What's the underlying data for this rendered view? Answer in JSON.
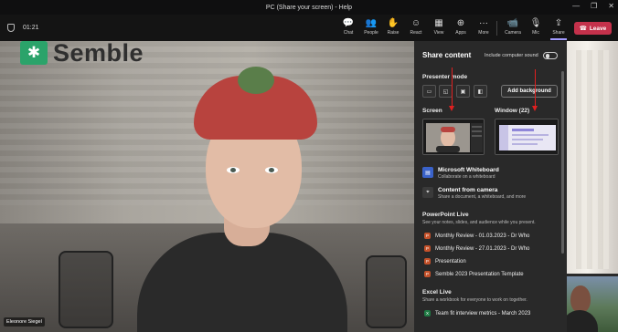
{
  "window": {
    "title": "PC (Share your screen) - Help",
    "min_glyph": "—",
    "max_glyph": "❐",
    "close_glyph": "✕"
  },
  "meeting": {
    "timer": "01:21"
  },
  "toolbar": {
    "buttons": [
      {
        "label": "Chat",
        "icon": "chat-icon",
        "glyph": "💬"
      },
      {
        "label": "People",
        "icon": "people-icon",
        "glyph": "👥"
      },
      {
        "label": "Raise",
        "icon": "raise-hand-icon",
        "glyph": "✋"
      },
      {
        "label": "React",
        "icon": "react-icon",
        "glyph": "☺"
      },
      {
        "label": "View",
        "icon": "view-icon",
        "glyph": "▦"
      },
      {
        "label": "Apps",
        "icon": "apps-icon",
        "glyph": "⊕"
      },
      {
        "label": "More",
        "icon": "more-icon",
        "glyph": "···"
      },
      {
        "label": "Camera",
        "icon": "camera-icon",
        "glyph": "📹"
      },
      {
        "label": "Mic",
        "icon": "mic-icon",
        "glyph": "🎙"
      },
      {
        "label": "Share",
        "icon": "share-icon",
        "glyph": "⇪"
      }
    ],
    "leave_label": "Leave",
    "leave_color": "#c4314b",
    "share_active_color": "#a29bff"
  },
  "video": {
    "participant_name": "Eleonore Siegel",
    "logo_text": "Semble",
    "logo_color": "#2ba36a"
  },
  "share_panel": {
    "title": "Share content",
    "include_sound_label": "Include computer sound",
    "include_sound_on": false,
    "presenter_mode_label": "Presenter mode",
    "presenter_modes": [
      "content-only-icon",
      "standout-icon",
      "reporter-icon",
      "side-by-side-icon"
    ],
    "add_background_label": "Add background",
    "screen_label": "Screen",
    "window_label": "Window (22)",
    "annotation_arrow_color": "#e02020",
    "whiteboard_title": "Microsoft Whiteboard",
    "whiteboard_sub": "Collaborate on a whiteboard",
    "camera_title": "Content from camera",
    "camera_sub": "Share a document, a whiteboard, and more",
    "powerpoint_title": "PowerPoint Live",
    "powerpoint_sub": "See your notes, slides, and audience while you present.",
    "powerpoint_files": [
      "Monthly Review - 01.03.2023 - Dr Who",
      "Monthly Review - 27.01.2023 - Dr Who",
      "Presentation",
      "Semble 2023 Presentation Template"
    ],
    "excel_title": "Excel Live",
    "excel_sub": "Share a workbook for everyone to work on together.",
    "excel_files": [
      "Team fit interview metrics - March 2023"
    ]
  }
}
